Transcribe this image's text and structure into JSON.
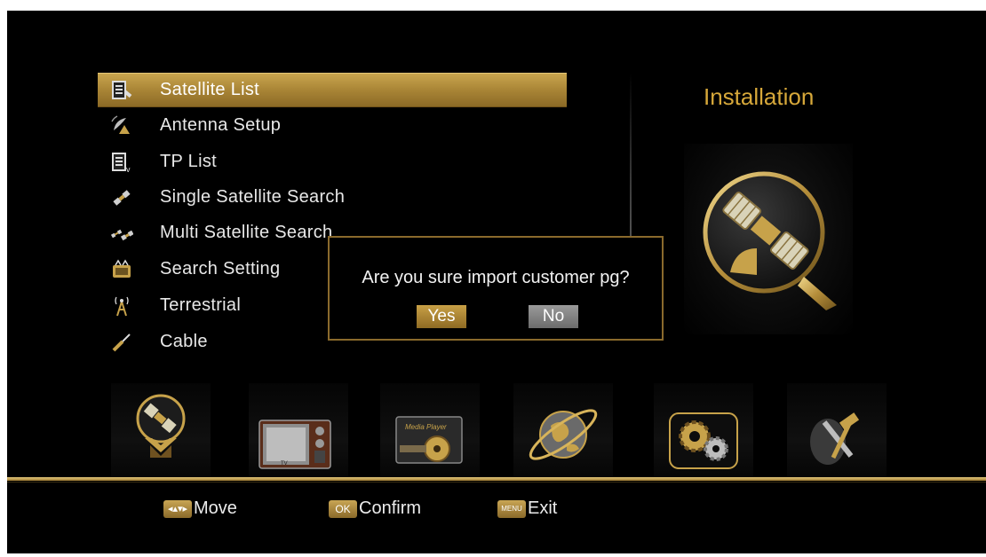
{
  "menu": {
    "items": [
      {
        "label": "Satellite List",
        "icon": "satellite-list-icon",
        "selected": true
      },
      {
        "label": "Antenna Setup",
        "icon": "antenna-dish-icon",
        "selected": false
      },
      {
        "label": "TP List",
        "icon": "tp-list-icon",
        "selected": false
      },
      {
        "label": "Single Satellite Search",
        "icon": "single-satellite-icon",
        "selected": false
      },
      {
        "label": "Multi Satellite Search",
        "icon": "multi-satellite-icon",
        "selected": false
      },
      {
        "label": "Search Setting",
        "icon": "search-setting-icon",
        "selected": false
      },
      {
        "label": "Terrestrial",
        "icon": "terrestrial-tower-icon",
        "selected": false
      },
      {
        "label": "Cable",
        "icon": "cable-connector-icon",
        "selected": false
      }
    ]
  },
  "panel": {
    "title": "Installation",
    "icon": "satellite-installation-icon"
  },
  "dialog": {
    "message": "Are you sure import customer pg?",
    "yes_label": "Yes",
    "no_label": "No",
    "focused": "Yes"
  },
  "categories": [
    {
      "name": "installation",
      "icon": "satellite-category-icon",
      "active": true
    },
    {
      "name": "channel",
      "icon": "tv-category-icon",
      "label": "TV",
      "active": false
    },
    {
      "name": "media",
      "icon": "media-player-icon",
      "label": "Media Player",
      "active": false
    },
    {
      "name": "network",
      "icon": "globe-category-icon",
      "active": false
    },
    {
      "name": "system",
      "icon": "gears-category-icon",
      "active": false
    },
    {
      "name": "tools",
      "icon": "tools-category-icon",
      "active": false
    }
  ],
  "hints": {
    "move": {
      "key": "◂▴▾▸",
      "label": "Move"
    },
    "confirm": {
      "key": "OK",
      "label": "Confirm"
    },
    "exit": {
      "key": "MENU",
      "label": "Exit"
    }
  },
  "colors": {
    "accent_gold": "#d7a83a",
    "selection_gold": "#a98536",
    "background": "#000000"
  }
}
